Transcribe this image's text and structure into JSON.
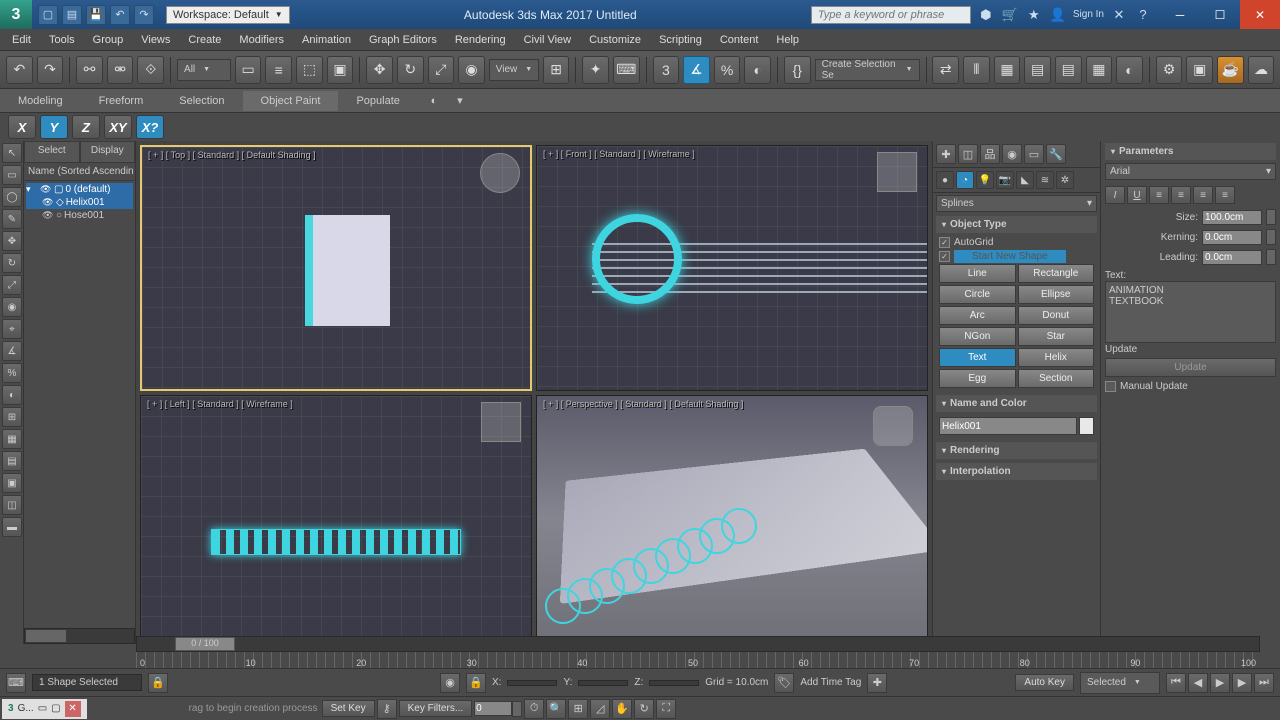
{
  "app": {
    "title": "Autodesk 3ds Max 2017     Untitled",
    "workspace": "Workspace: Default",
    "search_placeholder": "Type a keyword or phrase",
    "signin": "Sign In",
    "logo_watermark": "3"
  },
  "menu": [
    "Edit",
    "Tools",
    "Group",
    "Views",
    "Create",
    "Modifiers",
    "Animation",
    "Graph Editors",
    "Rendering",
    "Civil View",
    "Customize",
    "Scripting",
    "Content",
    "Help"
  ],
  "maintool": {
    "filter": "All",
    "view": "View",
    "selset": "Create Selection Se"
  },
  "ribbon": [
    "Modeling",
    "Freeform",
    "Selection",
    "Object Paint",
    "Populate"
  ],
  "axis": [
    "X",
    "Y",
    "Z",
    "XY",
    "X?"
  ],
  "side": {
    "tab1": "Select",
    "tab2": "Display",
    "hdr": "Name (Sorted Ascendin",
    "items": [
      {
        "label": "0 (default)",
        "depth": 0,
        "sel": true
      },
      {
        "label": "Helix001",
        "depth": 1,
        "sel": true
      },
      {
        "label": "Hose001",
        "depth": 1,
        "sel": false
      }
    ]
  },
  "viewports": {
    "top": "[ + ] [ Top ] [ Standard ] [ Default Shading ]",
    "front": "[ + ] [ Front ] [ Standard ] [ Wireframe ]",
    "left": "[ + ] [ Left ] [ Standard ] [ Wireframe ]",
    "persp": "[ + ] [ Perspective ] [ Standard ] [ Default Shading ]"
  },
  "cmd": {
    "category": "Splines",
    "objtype_title": "Object Type",
    "autogrid": "AutoGrid",
    "newshape": "Start New Shape",
    "buttons": [
      "Line",
      "Rectangle",
      "Circle",
      "Ellipse",
      "Arc",
      "Donut",
      "NGon",
      "Star",
      "Text",
      "Helix",
      "Egg",
      "Section"
    ],
    "namecolor_title": "Name and Color",
    "name_value": "Helix001",
    "rendering_title": "Rendering",
    "interp_title": "Interpolation"
  },
  "params": {
    "title": "Parameters",
    "font": "Arial",
    "size_label": "Size:",
    "size": "100.0cm",
    "kerning_label": "Kerning:",
    "kerning": "0.0cm",
    "leading_label": "Leading:",
    "leading": "0.0cm",
    "text_label": "Text:",
    "text_value": "ANIMATION\nTEXTBOOK",
    "update_label": "Update",
    "update_btn": "Update",
    "manual": "Manual Update"
  },
  "timeline": {
    "knob": "0 / 100",
    "ticks": [
      "0",
      "10",
      "20",
      "30",
      "40",
      "50",
      "60",
      "70",
      "80",
      "90",
      "100"
    ]
  },
  "status": {
    "selected": "1 Shape Selected",
    "x": "X:",
    "y": "Y:",
    "z": "Z:",
    "grid": "Grid = 10.0cm",
    "addtag": "Add Time Tag",
    "autokey": "Auto Key",
    "selected_dd": "Selected",
    "setkey": "Set Key",
    "keyfilters": "Key Filters...",
    "frame": "0",
    "maxscript": "rag to begin creation process"
  },
  "taskbar": {
    "item": "G..."
  }
}
